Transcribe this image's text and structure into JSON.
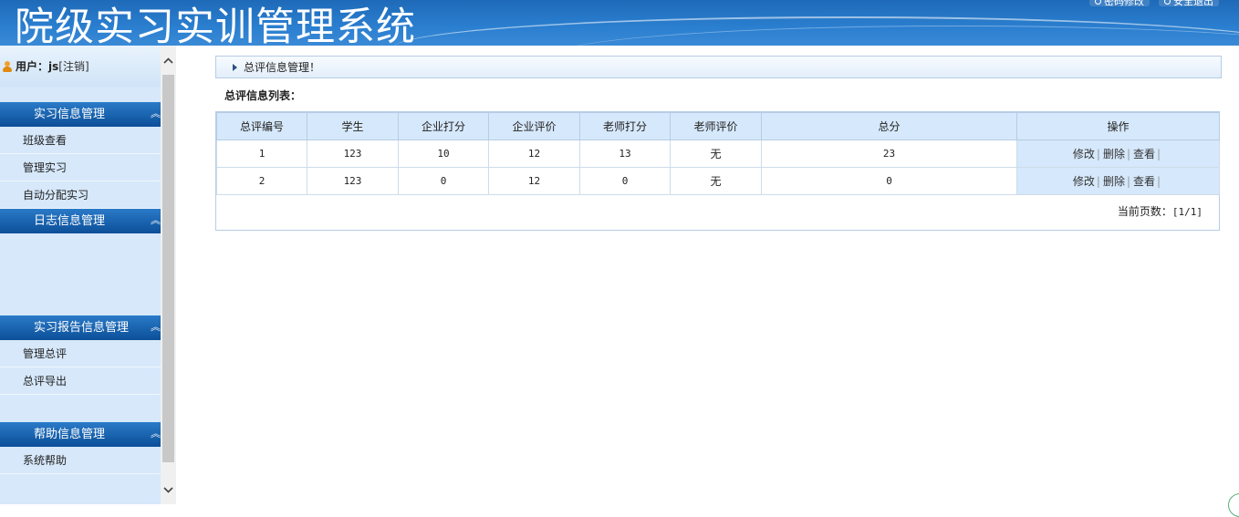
{
  "app": {
    "title": "院级实习实训管理系统",
    "top_links": [
      "密码修改",
      "安全退出"
    ]
  },
  "user": {
    "label": "用户：",
    "name": "js",
    "logout": "[注销]"
  },
  "sidebar": {
    "sections": [
      {
        "title": "实习信息管理",
        "items": [
          "班级查看",
          "管理实习",
          "自动分配实习"
        ]
      },
      {
        "title": "日志信息管理",
        "items": []
      },
      {
        "title": "实习报告信息管理",
        "items": [
          "管理总评",
          "总评导出"
        ]
      },
      {
        "title": "帮助信息管理",
        "items": [
          "系统帮助"
        ]
      }
    ]
  },
  "breadcrumb": "总评信息管理！",
  "list_title": "总评信息列表：",
  "table": {
    "columns": [
      "总评编号",
      "学生",
      "企业打分",
      "企业评价",
      "老师打分",
      "老师评价",
      "总分",
      "操作"
    ],
    "rows": [
      {
        "id": "1",
        "student": "123",
        "company_score": "10",
        "company_eval": "12",
        "teacher_score": "13",
        "teacher_eval": "无",
        "total": "23"
      },
      {
        "id": "2",
        "student": "123",
        "company_score": "0",
        "company_eval": "12",
        "teacher_score": "0",
        "teacher_eval": "无",
        "total": "0"
      }
    ],
    "actions": [
      "修改",
      "删除",
      "查看"
    ]
  },
  "pager": {
    "label": "当前页数：",
    "value": "[1/1]"
  }
}
